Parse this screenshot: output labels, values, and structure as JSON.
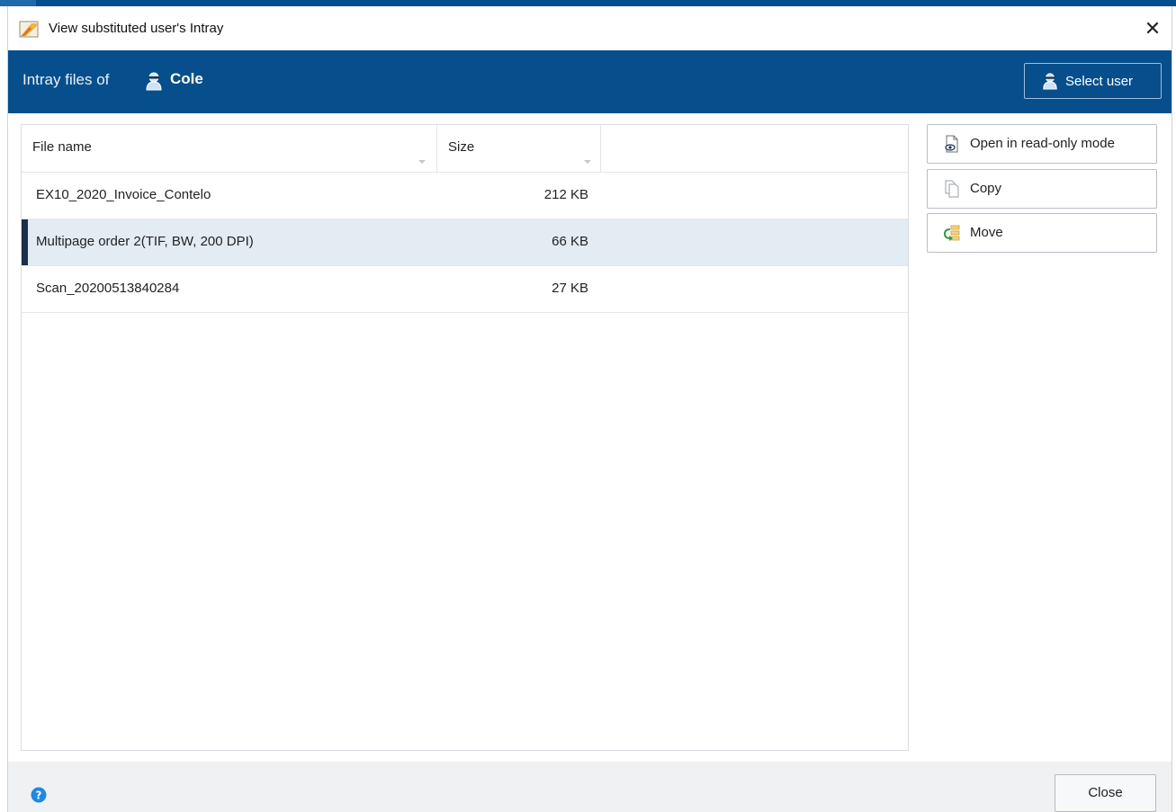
{
  "window": {
    "title": "View substituted user's Intray"
  },
  "header": {
    "prefix": "Intray files of",
    "user": "Cole",
    "select_user_label": "Select user"
  },
  "table": {
    "columns": [
      "File name",
      "Size"
    ],
    "rows": [
      {
        "name": "EX10_2020_Invoice_Contelo",
        "size": "212 KB",
        "selected": false
      },
      {
        "name": "Multipage order 2(TIF, BW, 200 DPI)",
        "size": "66 KB",
        "selected": true
      },
      {
        "name": "Scan_20200513840284",
        "size": "27 KB",
        "selected": false
      }
    ]
  },
  "actions": {
    "open_readonly": "Open in read-only mode",
    "copy": "Copy",
    "move": "Move"
  },
  "footer": {
    "close_label": "Close"
  },
  "colors": {
    "header_bg": "#064f8c",
    "selected_row": "#e3ecf3",
    "selected_bar": "#1b2f4a",
    "help": "#1e88e5"
  }
}
